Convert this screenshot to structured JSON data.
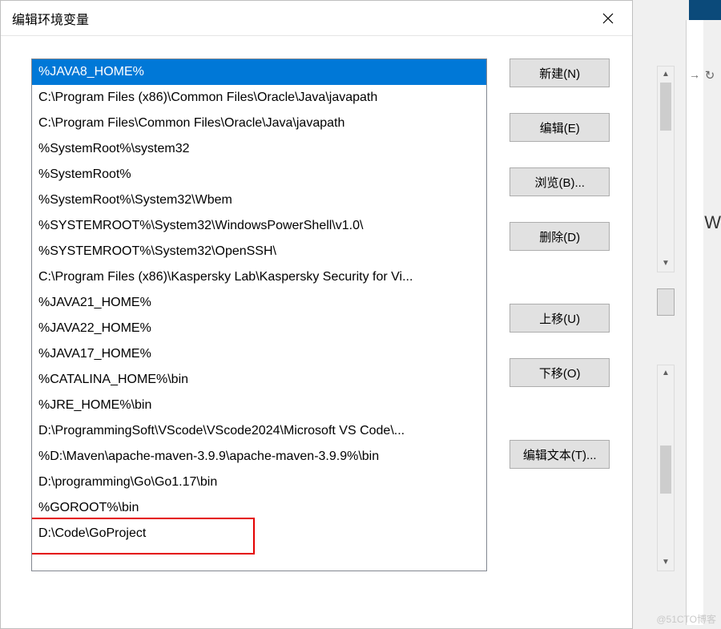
{
  "dialog": {
    "title": "编辑环境变量",
    "selected_index": 0,
    "items": [
      "%JAVA8_HOME%",
      "C:\\Program Files (x86)\\Common Files\\Oracle\\Java\\javapath",
      "C:\\Program Files\\Common Files\\Oracle\\Java\\javapath",
      "%SystemRoot%\\system32",
      "%SystemRoot%",
      "%SystemRoot%\\System32\\Wbem",
      "%SYSTEMROOT%\\System32\\WindowsPowerShell\\v1.0\\",
      "%SYSTEMROOT%\\System32\\OpenSSH\\",
      "C:\\Program Files (x86)\\Kaspersky Lab\\Kaspersky Security for Vi...",
      "%JAVA21_HOME%",
      "%JAVA22_HOME%",
      "%JAVA17_HOME%",
      "%CATALINA_HOME%\\bin",
      "%JRE_HOME%\\bin",
      "D:\\ProgrammingSoft\\VScode\\VScode2024\\Microsoft VS Code\\...",
      "%D:\\Maven\\apache-maven-3.9.9\\apache-maven-3.9.9%\\bin",
      "D:\\programming\\Go\\Go1.17\\bin",
      "%GOROOT%\\bin",
      "D:\\Code\\GoProject"
    ],
    "highlight_index": 18,
    "buttons": {
      "new": "新建(N)",
      "edit": "编辑(E)",
      "browse": "浏览(B)...",
      "delete": "删除(D)",
      "moveup": "上移(U)",
      "movedown": "下移(O)",
      "edittext": "编辑文本(T)..."
    }
  },
  "background": {
    "w_label": "W",
    "refresh": "↻",
    "arrow": "→"
  },
  "watermark": "@51CTO博客"
}
